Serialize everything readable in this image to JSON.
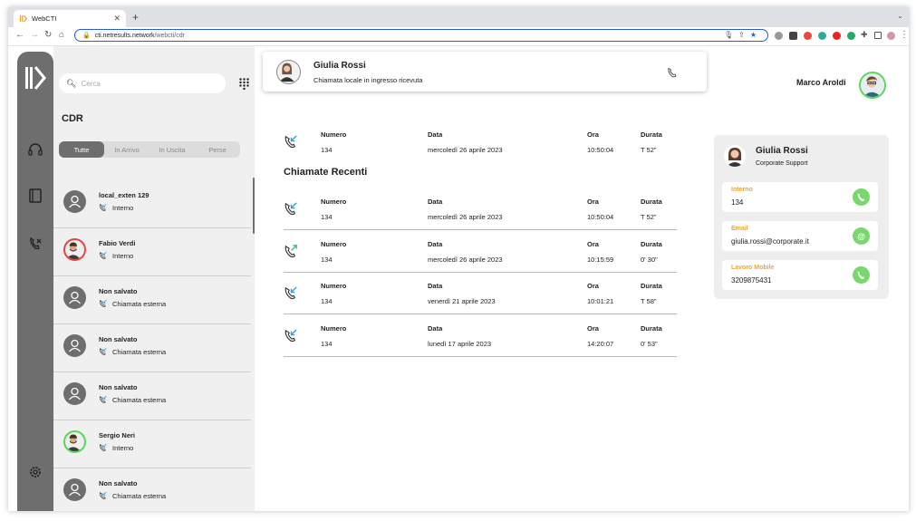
{
  "browser": {
    "tab_title": "WebCTI",
    "url_host": "cti.netresults.network",
    "url_path": "/webcti/cdr"
  },
  "search": {
    "placeholder": "Cerca"
  },
  "cdr": {
    "title": "CDR",
    "filters": [
      {
        "label": "Tutte",
        "active": true
      },
      {
        "label": "In Arrivo",
        "active": false
      },
      {
        "label": "In Uscita",
        "active": false
      },
      {
        "label": "Perse",
        "active": false
      }
    ]
  },
  "contacts": [
    {
      "name": "local_exten 129",
      "sub": "Interno",
      "avatar": "user-icon"
    },
    {
      "name": "Fabio Verdi",
      "sub": "Interno",
      "avatar": "photo",
      "ring": "#e04848"
    },
    {
      "name": "Non salvato",
      "sub": "Chiamata esterna",
      "avatar": "user-icon"
    },
    {
      "name": "Non salvato",
      "sub": "Chiamata esterna",
      "avatar": "user-icon"
    },
    {
      "name": "Non salvato",
      "sub": "Chiamata esterna",
      "avatar": "user-icon"
    },
    {
      "name": "Sergio Neri",
      "sub": "Interno",
      "avatar": "photo",
      "ring": "#5cd65c"
    },
    {
      "name": "Non salvato",
      "sub": "Chiamata esterna",
      "avatar": "user-icon"
    }
  ],
  "current_call": {
    "name": "Giulia Rossi",
    "status": "Chiamata locale in ingresso ricevuta"
  },
  "user": {
    "name": "Marco Aroldi"
  },
  "headers": {
    "numero": "Numero",
    "data": "Data",
    "ora": "Ora",
    "durata": "Durata"
  },
  "current_cdr": {
    "direction": "incoming",
    "numero": "134",
    "data": "mercoledì 26 aprile 2023",
    "ora": "10:50:04",
    "durata": "T 52\""
  },
  "recent_title": "Chiamate Recenti",
  "recent_calls": [
    {
      "direction": "incoming",
      "numero": "134",
      "data": "mercoledì 26 aprile 2023",
      "ora": "10:50:04",
      "durata": "T 52\""
    },
    {
      "direction": "outgoing",
      "numero": "134",
      "data": "mercoledì 26 aprile 2023",
      "ora": "10:15:59",
      "durata": "0' 30\""
    },
    {
      "direction": "incoming",
      "numero": "134",
      "data": "venerdì 21 aprile 2023",
      "ora": "10:01:21",
      "durata": "T 58\""
    },
    {
      "direction": "incoming",
      "numero": "134",
      "data": "lunedì 17 aprile 2023",
      "ora": "14:20:07",
      "durata": "0' 53\""
    }
  ],
  "detail": {
    "name": "Giulia Rossi",
    "role": "Corporate Support",
    "fields": [
      {
        "label": "Interno",
        "value": "134",
        "action": "phone-icon"
      },
      {
        "label": "Email",
        "value": "giulia.rossi@corporate.it",
        "action": "at-icon",
        "action_glyph": "@"
      },
      {
        "label": "Lavoro Mobile",
        "value": "3209875431",
        "action": "phone-icon"
      }
    ]
  },
  "colors": {
    "rail": "#6e6e6e",
    "accent_orange": "#e8a73a",
    "call_green": "#78d86b",
    "incoming_blue": "#2aa3d8",
    "outgoing_green": "#3cc47c"
  }
}
